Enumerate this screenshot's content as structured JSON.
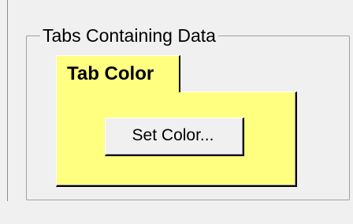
{
  "groupbox": {
    "title": "Tabs Containing Data"
  },
  "tabs": [
    {
      "label": "Tab Color",
      "selected": true,
      "color": "#ffff80"
    }
  ],
  "panel": {
    "button_label": "Set Color..."
  }
}
